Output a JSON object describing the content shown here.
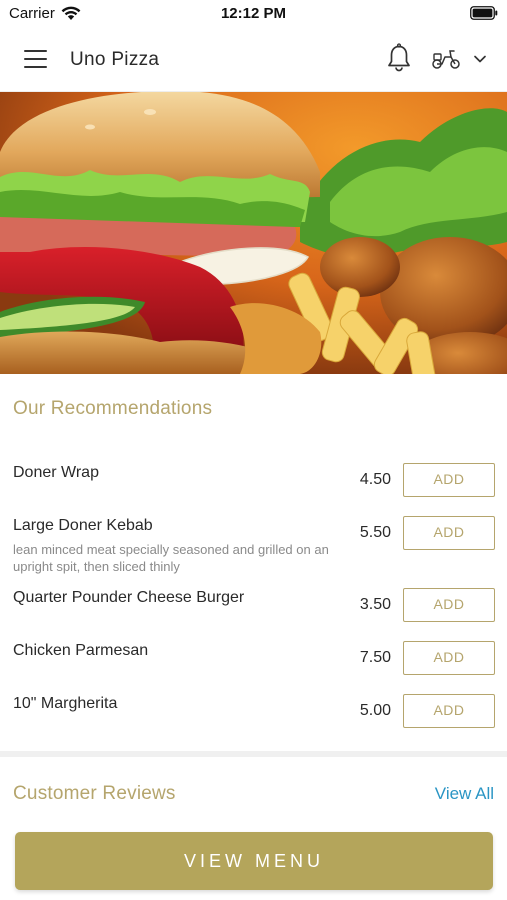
{
  "status_bar": {
    "carrier": "Carrier",
    "time": "12:12 PM",
    "wifi_icon": "wifi-icon",
    "battery_icon": "battery-icon"
  },
  "header": {
    "title": "Uno Pizza",
    "menu_icon": "hamburger-menu-icon",
    "notification_icon": "bell-icon",
    "delivery_icon": "scooter-icon",
    "dropdown_icon": "chevron-down-icon"
  },
  "hero": {
    "image": "food-photo-burger-fries"
  },
  "recommendations": {
    "title": "Our Recommendations",
    "items": [
      {
        "name": "Doner Wrap",
        "description": "",
        "price": "4.50",
        "button": "ADD"
      },
      {
        "name": "Large Doner Kebab",
        "description": "lean minced meat specially seasoned and grilled on an upright spit, then sliced thinly",
        "price": "5.50",
        "button": "ADD"
      },
      {
        "name": "Quarter Pounder Cheese Burger",
        "description": "",
        "price": "3.50",
        "button": "ADD"
      },
      {
        "name": "Chicken Parmesan",
        "description": "",
        "price": "7.50",
        "button": "ADD"
      },
      {
        "name": "10\" Margherita",
        "description": "",
        "price": "5.00",
        "button": "ADD"
      }
    ]
  },
  "reviews": {
    "title": "Customer Reviews",
    "view_all": "View All"
  },
  "footer": {
    "view_menu": "VIEW MENU"
  },
  "colors": {
    "accent": "#b5a56d",
    "button_bg": "#b4a55b",
    "link": "#2a95c4"
  }
}
